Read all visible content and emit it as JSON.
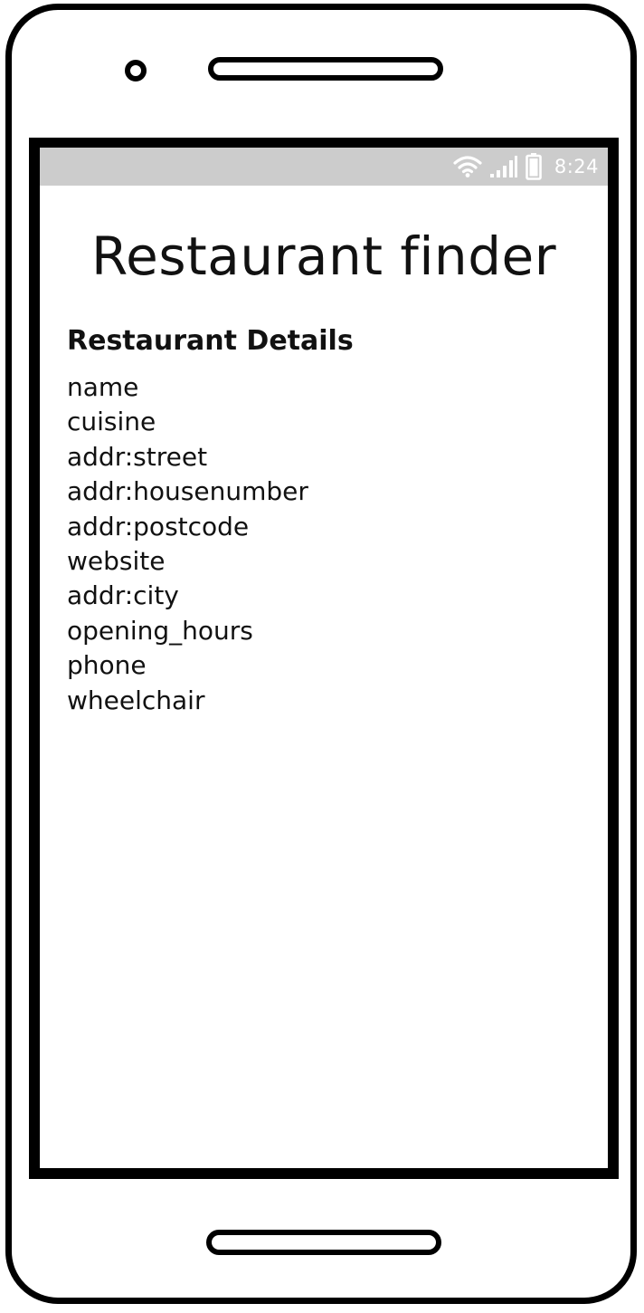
{
  "status_bar": {
    "time": "8:24",
    "icons": [
      "wifi-icon",
      "signal-icon",
      "battery-icon"
    ]
  },
  "app": {
    "title": "Restaurant finder"
  },
  "details": {
    "heading": "Restaurant Details",
    "fields": [
      "name",
      "cuisine",
      "addr:street",
      "addr:housenumber",
      "addr:postcode",
      "website",
      "addr:city",
      "opening_hours",
      "phone",
      "wheelchair"
    ]
  },
  "colors": {
    "status_bar": "#cccccc",
    "frame": "#000000",
    "background": "#ffffff",
    "text": "#111111"
  }
}
